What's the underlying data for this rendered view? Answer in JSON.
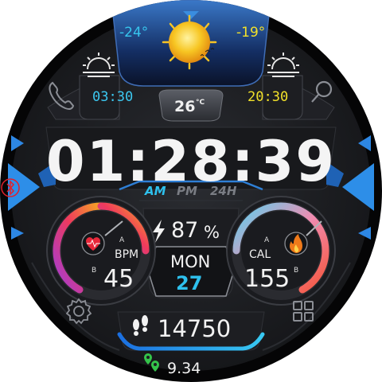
{
  "weather": {
    "temp_low": "-24°",
    "temp_high": "-19°",
    "sunrise_time": "03:30",
    "sunset_time": "20:30",
    "current_temp": "26",
    "current_temp_unit": "°C"
  },
  "clock": {
    "time": "01:28:39",
    "am_label": "AM",
    "pm_label": "PM",
    "h24_label": "24H"
  },
  "battery": {
    "percent": "87",
    "unit": "%",
    "level": 0.87
  },
  "date": {
    "weekday": "MON",
    "day": "27"
  },
  "heart_rate": {
    "value": "45",
    "unit": "BPM",
    "gauge_a": "A",
    "gauge_b": "B"
  },
  "calories": {
    "value": "155",
    "unit": "CAL",
    "gauge_a": "A",
    "gauge_b": "B"
  },
  "steps": {
    "value": "14750"
  },
  "distance": {
    "value": "9.34"
  },
  "icons": [
    "sun-icon",
    "sunrise-icon",
    "sunset-icon",
    "phone-icon",
    "search-icon",
    "bluetooth-icon",
    "bolt-icon",
    "heart-icon",
    "flame-icon",
    "gear-icon",
    "apps-grid-icon",
    "footprints-icon",
    "location-pins-icon"
  ],
  "colors": {
    "accent_blue": "#2ec1ee",
    "accent_yellow": "#f2e12a",
    "bluetooth_red": "#e0202a",
    "background": "#1c1d21",
    "bezel": "#000000"
  }
}
